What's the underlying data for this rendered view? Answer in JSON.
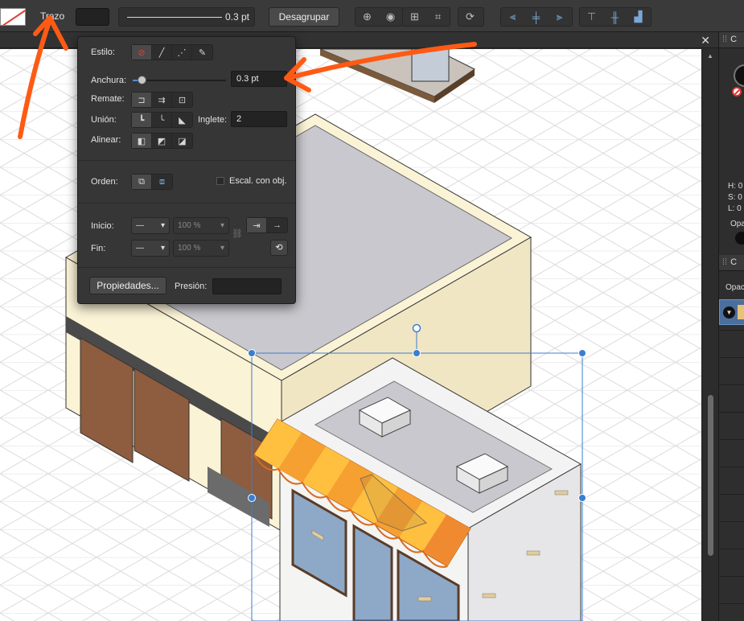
{
  "toolbar": {
    "stroke_label": "Trazo",
    "stroke_width_value": "0.3 pt",
    "ungroup_label": "Desagrupar",
    "tool_icons": [
      "snapping-icon",
      "view-icon",
      "distribute-icon",
      "transform-icon",
      "rotate-icon"
    ],
    "align_icons": [
      "align-left-icon",
      "align-center-icon",
      "align-right-icon",
      "align-top-icon",
      "align-middle-icon",
      "align-bottom-icon"
    ]
  },
  "stroke_popup": {
    "style_label": "Estilo:",
    "width_label": "Anchura:",
    "width_value": "0.3 pt",
    "cap_label": "Remate:",
    "join_label": "Unión:",
    "miter_label": "Inglete:",
    "miter_value": "2",
    "align_label": "Alinear:",
    "order_label": "Orden:",
    "scale_label": "Escal. con obj.",
    "start_label": "Inicio:",
    "end_label": "Fin:",
    "start_percent": "100 %",
    "end_percent": "100 %",
    "properties_label": "Propiedades...",
    "pressure_label": "Presión:"
  },
  "right_panel": {
    "color_tab": "C",
    "layers_tab": "C",
    "h_value": "H: 0",
    "s_value": "S: 0",
    "l_value": "L: 0",
    "opacity_label": "Opa",
    "layers_opacity_label": "Opac"
  },
  "colors": {
    "annotation_arrow": "#ff5a14",
    "selection": "#3a7fcf",
    "awning_light": "#ffc040",
    "awning_dark": "#f08a30",
    "wall_cream": "#fbf3d6",
    "roof_gray": "#c9c8ce"
  }
}
